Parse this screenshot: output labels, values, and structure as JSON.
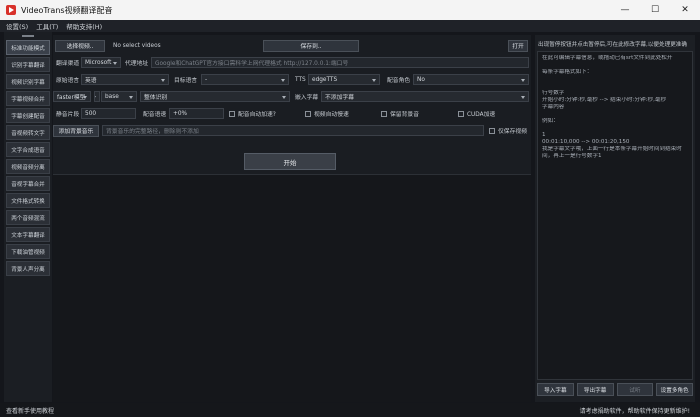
{
  "window": {
    "title": "VideoTrans视频翻译配音",
    "minimize": "—",
    "maximize": "☐",
    "close": "✕"
  },
  "menu": [
    "设置(S)",
    "工具(T)",
    "帮助支持(H)"
  ],
  "sidebar": {
    "items": [
      "标准功能模式",
      "识别字幕翻译",
      "视频识别字幕",
      "字幕视频合并",
      "字幕创建配音",
      "音视频转文字",
      "文字合成语音",
      "视频音频分离",
      "音视字幕合并",
      "文件格式转换",
      "两个音频混流",
      "文本字幕翻译",
      "下载油管视频",
      "背景人声分离"
    ]
  },
  "main": {
    "select_video_button": "选择视频..",
    "no_video_text": "No select videos",
    "save_to_button": "保存到..",
    "open_button": "打开",
    "translate_channel_label": "翻译渠道",
    "translate_channel_value": "Microsoft",
    "proxy_label": "代理地址",
    "proxy_placeholder": "Google和ChatGPT官方接口需科学上网代理格式 http://127.0.0.1:端口号",
    "source_lang_label": "原始语言",
    "source_lang_value": "英语",
    "target_lang_label": "目标语言",
    "target_lang_value": "-",
    "tts_label": "TTS",
    "tts_value": "edgeTTS",
    "voice_role_label": "配音角色",
    "voice_role_value": "No",
    "whisper_model_value": "faster模型",
    "model_size_value": "base",
    "recognize_mode_value": "整体识别",
    "embed_subtitle_label": "嵌入字幕",
    "embed_subtitle_value": "不添加字幕",
    "silence_label": "静音片段",
    "silence_value": "500",
    "voice_rate_label": "配音语速",
    "voice_rate_value": "+0%",
    "voice_autorate_label": "配音自动加速?",
    "video_autorate_label": "视频自动慢速",
    "keep_bgm_label": "保留背景音",
    "cuda_label": "CUDA加速",
    "add_bgm_button": "添加背景音乐",
    "bgm_placeholder": "背景音乐的完整路径，删除则不添加",
    "keep_original_label": "仅保存视频",
    "start_button": "开始"
  },
  "right_panel": {
    "hint": "出现暂停按钮并点击暂停后,可在此修改字幕,以便处理更准确",
    "lines": [
      "在此可编辑字幕信息，或拖动已有srt文件到此处松开",
      "",
      "每条字幕格式如下：",
      "",
      "",
      "行号数字",
      "开始小时:分钟:秒,毫秒 --> 结束小时:分钟:秒,毫秒",
      "字幕内容",
      "",
      "例如：",
      "",
      "1",
      "00:01:10,000 --> 00:01:20,150",
      "我是字幕文字哦，上面一行是本条字幕开始时间到结束时",
      "间，再上一是行号数字1"
    ],
    "buttons": [
      "导入字幕",
      "导出字幕",
      "试听",
      "设置多角色"
    ]
  },
  "statusbar": {
    "left": "查看新手使用教程",
    "right": "请考虑捐助软件，帮助软件保持更新维护!"
  }
}
